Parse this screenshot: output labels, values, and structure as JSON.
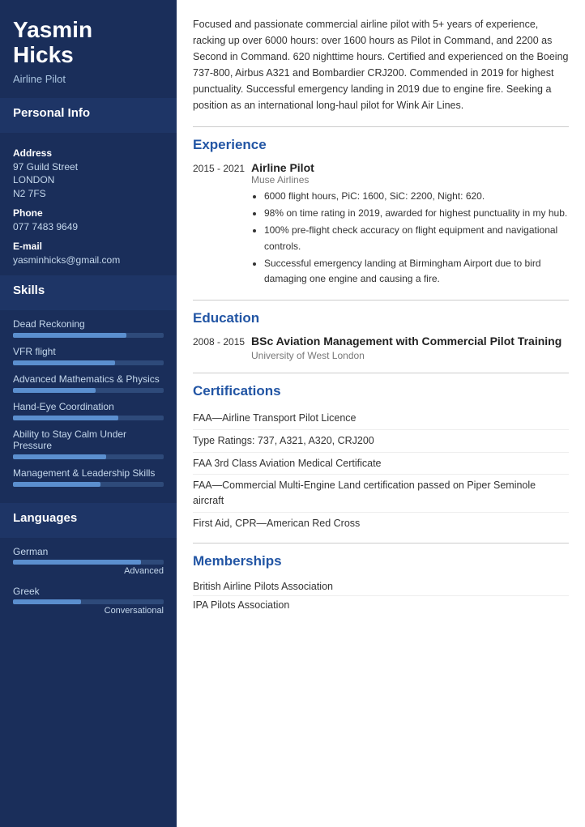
{
  "sidebar": {
    "name_line1": "Yasmin",
    "name_line2": "Hicks",
    "job_title": "Airline Pilot",
    "personal_info_label": "Personal Info",
    "address_label": "Address",
    "address_line1": "97 Guild Street",
    "address_line2": "LONDON",
    "address_line3": "N2 7FS",
    "phone_label": "Phone",
    "phone_value": "077 7483 9649",
    "email_label": "E-mail",
    "email_value": "yasminhicks@gmail.com",
    "skills_label": "Skills",
    "skills": [
      {
        "name": "Dead Reckoning",
        "pct": 75
      },
      {
        "name": "VFR flight",
        "pct": 68
      },
      {
        "name": "Advanced Mathematics & Physics",
        "pct": 55
      },
      {
        "name": "Hand-Eye Coordination",
        "pct": 70
      },
      {
        "name": "Ability to Stay Calm Under Pressure",
        "pct": 62
      },
      {
        "name": "Management & Leadership Skills",
        "pct": 58
      }
    ],
    "languages_label": "Languages",
    "languages": [
      {
        "name": "German",
        "level": "Advanced",
        "pct": 85
      },
      {
        "name": "Greek",
        "level": "Conversational",
        "pct": 45
      }
    ]
  },
  "main": {
    "summary": "Focused and passionate commercial airline pilot with 5+ years of experience, racking up over 6000 hours: over 1600 hours as Pilot in Command, and 2200 as Second in Command. 620 nighttime hours. Certified and experienced on the Boeing 737-800, Airbus A321 and Bombardier CRJ200. Commended in 2019 for highest punctuality. Successful emergency landing in 2019 due to engine fire. Seeking a position as an international long-haul pilot for Wink Air Lines.",
    "experience_label": "Experience",
    "experience": [
      {
        "date": "2015 - 2021",
        "job_title": "Airline Pilot",
        "company": "Muse  Airlines",
        "bullets": [
          "6000 flight hours, PiC: 1600, SiC: 2200, Night: 620.",
          "98% on time rating in 2019, awarded for highest punctuality in my hub.",
          "100% pre-flight check accuracy on flight equipment and navigational controls.",
          "Successful emergency landing at Birmingham Airport due to bird damaging one engine and causing a fire."
        ]
      }
    ],
    "education_label": "Education",
    "education": [
      {
        "date": "2008 - 2015",
        "degree": "BSc Aviation Management with Commercial Pilot Training",
        "university": "University of West London"
      }
    ],
    "certifications_label": "Certifications",
    "certifications": [
      "FAA—Airline Transport Pilot Licence",
      "Type Ratings: 737, A321, A320, CRJ200",
      "FAA 3rd Class Aviation Medical Certificate",
      "FAA—Commercial Multi-Engine Land certification passed on Piper Seminole aircraft",
      "First Aid, CPR—American Red Cross"
    ],
    "memberships_label": "Memberships",
    "memberships": [
      "British Airline Pilots Association",
      "IPA Pilots Association"
    ]
  }
}
